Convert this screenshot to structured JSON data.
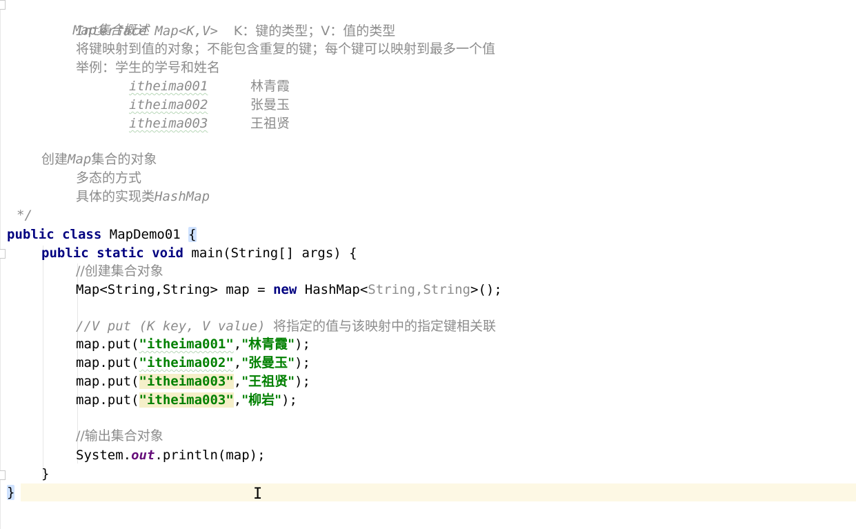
{
  "doc_comment": {
    "heading": "Map集合概述",
    "interface_line_code": "Interface Map<K,V>",
    "interface_line_desc_k": "K：键的类型；V：值的类型",
    "desc_line": "将键映射到值的对象；不能包含重复的键；每个键可以映射到最多一个值",
    "example_heading": "举例：学生的学号和姓名",
    "examples": [
      {
        "id": "itheima001",
        "name": "林青霞"
      },
      {
        "id": "itheima002",
        "name": "张曼玉"
      },
      {
        "id": "itheima003",
        "name": "王祖贤"
      }
    ],
    "create_heading_prefix": "创建",
    "create_heading_code": "Map",
    "create_heading_suffix": "集合的对象",
    "poly_line": "多态的方式",
    "impl_prefix": "具体的实现类",
    "impl_code": "HashMap",
    "close": "*/"
  },
  "code": {
    "kw_public": "public",
    "kw_class": "class",
    "class_name": "MapDemo01",
    "open_brace": "{",
    "kw_static": "static",
    "kw_void": "void",
    "main_sig": "main(String[] args) {",
    "comment_create": "//创建集合对象",
    "map_decl_left": "Map<String,String> map = ",
    "kw_new": "new",
    "map_decl_class": " HashMap<",
    "map_decl_generic": "String,String",
    "map_decl_end": ">();",
    "comment_put_code": "//V put (K key, V value) ",
    "comment_put_cn": "将指定的值与该映射中的指定键相关联",
    "puts": [
      {
        "key": "\"itheima001\"",
        "value": "\"林青霞\""
      },
      {
        "key": "\"itheima002\"",
        "value": "\"张曼玉\""
      },
      {
        "key": "\"itheima003\"",
        "value": "\"王祖贤\""
      },
      {
        "key": "\"itheima003\"",
        "value": "\"柳岩\""
      }
    ],
    "put_prefix": "map.put(",
    "put_sep": ",",
    "put_end": ");",
    "comment_output": "//输出集合对象",
    "println_prefix": "System.",
    "println_field": "out",
    "println_suffix": ".println(map);",
    "close_method": "}",
    "close_class": "}"
  },
  "cursor": "I"
}
